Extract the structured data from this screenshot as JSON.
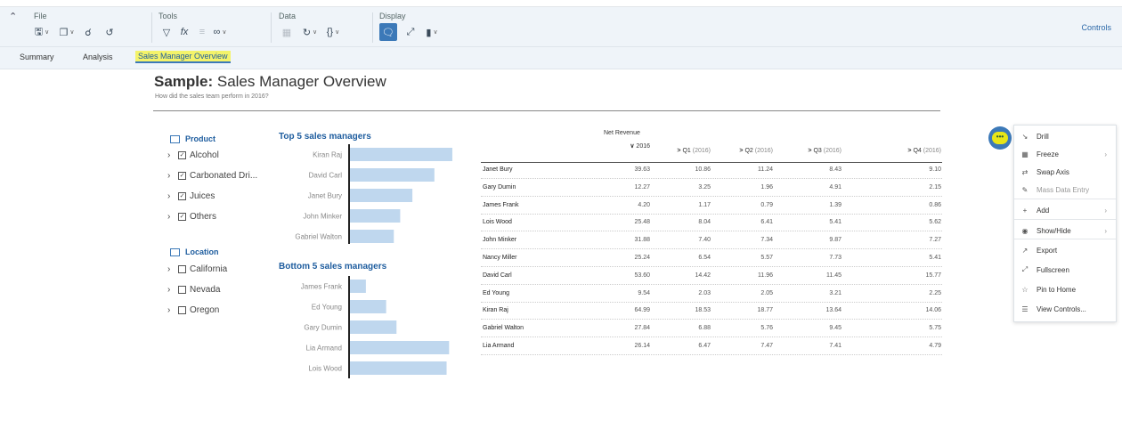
{
  "toolbar": {
    "groups": [
      {
        "label": "File"
      },
      {
        "label": "Tools"
      },
      {
        "label": "Data"
      },
      {
        "label": "Display"
      }
    ],
    "controls_label": "Controls"
  },
  "tabs": [
    {
      "label": "Summary"
    },
    {
      "label": "Analysis"
    },
    {
      "label": "Sales Manager Overview"
    }
  ],
  "story": {
    "title_bold": "Sample:",
    "title_rest": " Sales Manager Overview",
    "subtitle": "How did the sales team perform in 2016?"
  },
  "filters": {
    "product": {
      "label": "Product",
      "items": [
        {
          "label": "Alcohol",
          "checked": true
        },
        {
          "label": "Carbonated Dri...",
          "checked": true
        },
        {
          "label": "Juices",
          "checked": true
        },
        {
          "label": "Others",
          "checked": true
        }
      ]
    },
    "location": {
      "label": "Location",
      "items": [
        {
          "label": "California",
          "checked": false
        },
        {
          "label": "Nevada",
          "checked": false
        },
        {
          "label": "Oregon",
          "checked": false
        }
      ]
    }
  },
  "chart_data": [
    {
      "type": "bar",
      "orientation": "horizontal",
      "title": "Top 5 sales managers",
      "categories": [
        "Kiran Raj",
        "David Carl",
        "Janet Bury",
        "John Minker",
        "Gabriel Walton"
      ],
      "values": [
        64.99,
        53.6,
        39.63,
        31.88,
        27.84
      ],
      "xlim": [
        0,
        65
      ],
      "color": "#bfd7ee"
    },
    {
      "type": "bar",
      "orientation": "horizontal",
      "title": "Bottom 5 sales managers",
      "categories": [
        "James Frank",
        "Ed Young",
        "Gary Dumin",
        "Lia Armand",
        "Lois Wood"
      ],
      "values": [
        4.2,
        9.54,
        12.27,
        26.14,
        25.48
      ],
      "xlim": [
        0,
        27
      ],
      "color": "#bfd7ee"
    }
  ],
  "table": {
    "measure": "Net Revenue",
    "columns": [
      {
        "label": "2016",
        "chev": "∨",
        "suffix": ""
      },
      {
        "label": "Q1",
        "chev": ">",
        "suffix": " (2016)"
      },
      {
        "label": "Q2",
        "chev": ">",
        "suffix": " (2016)"
      },
      {
        "label": "Q3",
        "chev": ">",
        "suffix": " (2016)"
      },
      {
        "label": "Q4",
        "chev": ">",
        "suffix": " (2016)"
      }
    ],
    "rows": [
      {
        "name": "Janet Bury",
        "values": [
          "39.63",
          "10.86",
          "11.24",
          "8.43",
          "9.10"
        ]
      },
      {
        "name": "Gary Dumin",
        "values": [
          "12.27",
          "3.25",
          "1.96",
          "4.91",
          "2.15"
        ]
      },
      {
        "name": "James Frank",
        "values": [
          "4.20",
          "1.17",
          "0.79",
          "1.39",
          "0.86"
        ]
      },
      {
        "name": "Lois Wood",
        "values": [
          "25.48",
          "8.04",
          "6.41",
          "5.41",
          "5.62"
        ]
      },
      {
        "name": "John Minker",
        "values": [
          "31.88",
          "7.40",
          "7.34",
          "9.87",
          "7.27"
        ]
      },
      {
        "name": "Nancy Miller",
        "values": [
          "25.24",
          "6.54",
          "5.57",
          "7.73",
          "5.41"
        ]
      },
      {
        "name": "David Carl",
        "values": [
          "53.60",
          "14.42",
          "11.96",
          "11.45",
          "15.77"
        ]
      },
      {
        "name": "Ed Young",
        "values": [
          "9.54",
          "2.03",
          "2.05",
          "3.21",
          "2.25"
        ]
      },
      {
        "name": "Kiran Raj",
        "values": [
          "64.99",
          "18.53",
          "18.77",
          "13.64",
          "14.06"
        ]
      },
      {
        "name": "Gabriel Walton",
        "values": [
          "27.84",
          "6.88",
          "5.76",
          "9.45",
          "5.75"
        ]
      },
      {
        "name": "Lia Armand",
        "values": [
          "26.14",
          "6.47",
          "7.47",
          "7.41",
          "4.79"
        ]
      }
    ]
  },
  "more_button": {
    "label": "•••"
  },
  "context_menu": {
    "items": [
      {
        "label": "Drill",
        "icon": "drill-icon",
        "glyph": "↘",
        "submenu": false,
        "disabled": false
      },
      {
        "label": "Freeze",
        "icon": "freeze-icon",
        "glyph": "▦",
        "submenu": true,
        "disabled": false
      },
      {
        "label": "Swap Axis",
        "icon": "swap-axis-icon",
        "glyph": "⇄",
        "submenu": false,
        "disabled": false
      },
      {
        "label": "Mass Data Entry",
        "icon": "mass-data-entry-icon",
        "glyph": "✎",
        "submenu": false,
        "disabled": true
      },
      {
        "label": "Add",
        "icon": "add-icon",
        "glyph": "+",
        "submenu": true,
        "disabled": false
      },
      {
        "label": "Show/Hide",
        "icon": "show-hide-icon",
        "glyph": "◉",
        "submenu": true,
        "disabled": false
      },
      {
        "label": "Export",
        "icon": "export-icon",
        "glyph": "↗",
        "submenu": false,
        "disabled": false
      },
      {
        "label": "Fullscreen",
        "icon": "fullscreen-icon",
        "glyph": "⤢",
        "submenu": false,
        "disabled": false
      },
      {
        "label": "Pin to Home",
        "icon": "pin-icon",
        "glyph": "☆",
        "submenu": false,
        "disabled": false
      },
      {
        "label": "View Controls...",
        "icon": "view-controls-icon",
        "glyph": "☰",
        "submenu": false,
        "disabled": false
      }
    ]
  }
}
